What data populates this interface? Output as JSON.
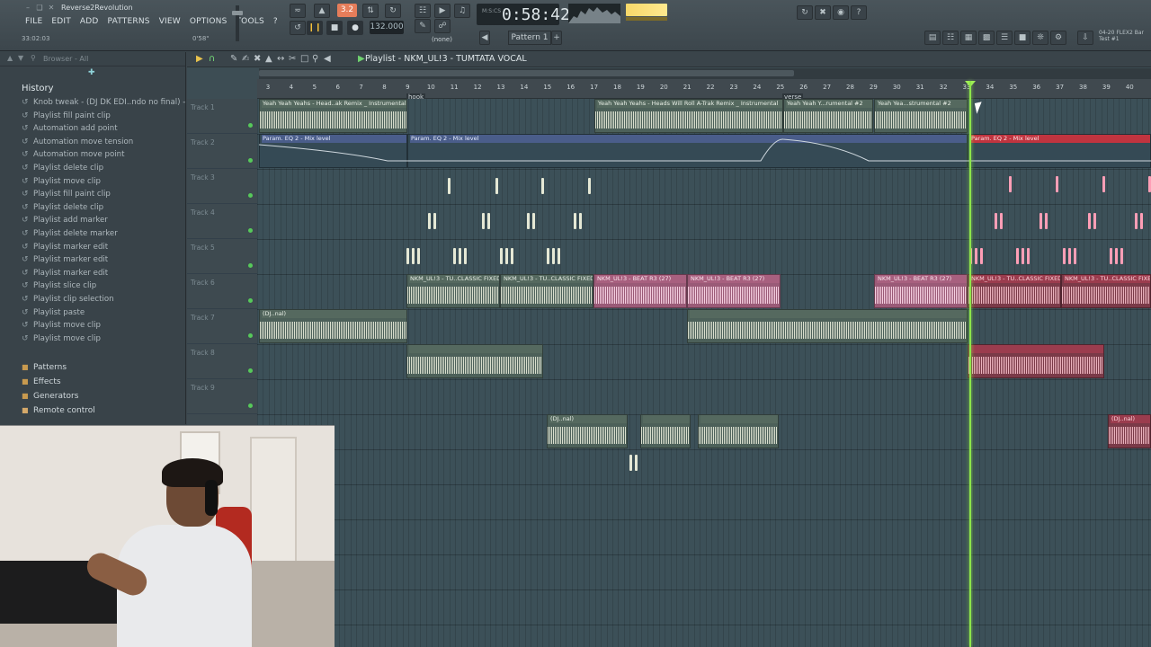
{
  "window": {
    "title": "Reverse2Revolution"
  },
  "menu": [
    "FILE",
    "EDIT",
    "ADD",
    "PATTERNS",
    "VIEW",
    "OPTIONS",
    "TOOLS",
    "?"
  ],
  "hints": {
    "left": "33:02:03",
    "right": "0'58\""
  },
  "transport": {
    "mode": "3.2",
    "tempo": "132.000",
    "time": "0:58:42",
    "time_units": "M:S:CS",
    "snap": "(none)",
    "pattern": "Pattern 1"
  },
  "flex": {
    "line1": "04-20 FLEX2 Bar",
    "line2": "Test #1"
  },
  "browser": {
    "header": "Browser - All",
    "history_title": "History",
    "history": [
      "Knob tweak - (DJ DK EDI..ndo no final) - Volume",
      "Playlist fill paint clip",
      "Automation add point",
      "Automation move tension",
      "Automation move point",
      "Playlist delete clip",
      "Playlist move clip",
      "Playlist fill paint clip",
      "Playlist delete clip",
      "Playlist add marker",
      "Playlist delete marker",
      "Playlist marker edit",
      "Playlist marker edit",
      "Playlist marker edit",
      "Playlist slice clip",
      "Playlist clip selection",
      "Playlist paste",
      "Playlist move clip",
      "Playlist move clip"
    ],
    "folders": [
      "Patterns",
      "Effects",
      "Generators",
      "Remote control"
    ]
  },
  "playlist": {
    "title": "Playlist - NKM_UL!3 - TUMTATA VOCAL",
    "bar_numbers": [
      "3",
      "4",
      "5",
      "6",
      "7",
      "8",
      "9",
      "10",
      "11",
      "12",
      "13",
      "14",
      "15",
      "16",
      "17",
      "18",
      "19",
      "20",
      "21",
      "22",
      "23",
      "24",
      "25",
      "26",
      "27",
      "28",
      "29",
      "30",
      "31",
      "32",
      "33",
      "34",
      "35",
      "36",
      "37",
      "38",
      "39",
      "40"
    ],
    "markers": {
      "hook": "hook",
      "verse": "verse"
    },
    "tracks": [
      "Track 1",
      "Track 2",
      "Track 3",
      "Track 4",
      "Track 5",
      "Track 6",
      "Track 7",
      "Track 8",
      "Track 9"
    ],
    "clips": {
      "t1a": "Yeah Yeah Yeahs - Head..ak Remix _ Instrumental",
      "t1b": "Yeah Yeah Yeahs - Heads Will Roll A-Trak Remix _ Instrumental",
      "t1c": "Yeah Yeah Y...rumental #2",
      "t1d": "Yeah Yea...strumental #2",
      "t2a": "Param. EQ 2 - Mix level",
      "t2b": "Param. EQ 2 - Mix level",
      "t2c": "Param. EQ 2 - Mix level",
      "t6a": "NKM_UL!3 - TU..CLASSIC FIXED",
      "t6b": "NKM_UL!3 - TU..CLASSIC FIXED",
      "t6c": "NKM_UL!3 - BEAT R3 (27)",
      "t6d": "NKM_UL!3 - BEAT R3 (27)",
      "t6e": "NKM_UL!3 - BEAT R3 (27)",
      "t6f": "NKM_UL!3 - TU..CLASSIC FIXED",
      "t6g": "NKM_UL!3 - TU..CLASSIC FIXED",
      "t7a": "(DJ..nal)",
      "t10a": "(DJ..nal)",
      "t10b": "(DJ..nal)"
    }
  },
  "colors": {
    "accent_orange": "#e57d5a",
    "playhead": "#8de64a",
    "clip_green": "#4c6059",
    "clip_pink": "#9a5a77",
    "clip_red": "#7a3a48",
    "led": "#56c95a"
  },
  "icons": [
    "pause-icon",
    "stop-icon",
    "record-icon",
    "metronome-icon",
    "pencil-icon",
    "paint-icon",
    "delete-icon",
    "mute-icon",
    "slice-icon",
    "select-icon",
    "zoom-icon",
    "playback-icon",
    "history-icon",
    "folder-icon",
    "help-icon"
  ]
}
